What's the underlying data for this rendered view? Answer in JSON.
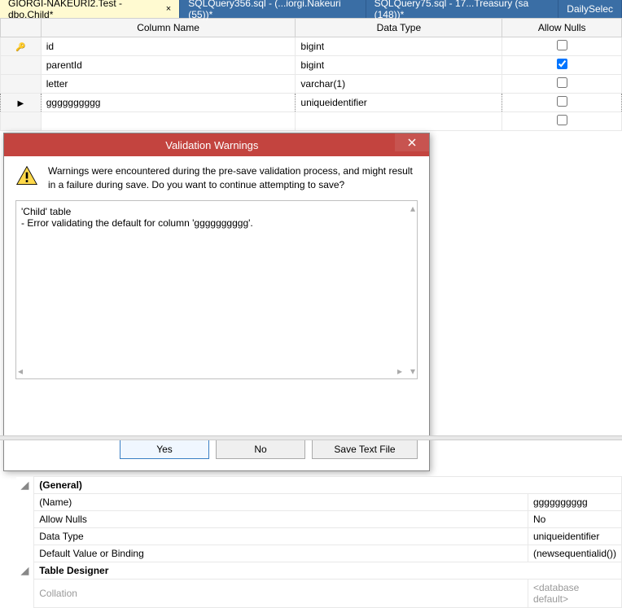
{
  "tabs": [
    {
      "label": "GIORGI-NAKEURI2.Test - dbo.Child*",
      "active": true
    },
    {
      "label": "SQLQuery356.sql - (...iorgi.Nakeuri (55))*",
      "active": false
    },
    {
      "label": "SQLQuery75.sql - 17...Treasury (sa (148))*",
      "active": false
    },
    {
      "label": "DailySelec",
      "active": false
    }
  ],
  "grid": {
    "headers": {
      "name": "Column Name",
      "type": "Data Type",
      "null": "Allow Nulls"
    },
    "rows": [
      {
        "key": true,
        "name": "id",
        "type": "bigint",
        "null": false
      },
      {
        "key": false,
        "name": "parentId",
        "type": "bigint",
        "null": true
      },
      {
        "key": false,
        "name": "letter",
        "type": "varchar(1)",
        "null": false
      },
      {
        "key": false,
        "editing": true,
        "name": "gggggggggg",
        "type": "uniqueidentifier",
        "null": false
      },
      {
        "key": false,
        "name": "",
        "type": "",
        "null": false
      }
    ]
  },
  "dialog": {
    "title": "Validation Warnings",
    "message": "Warnings were encountered during the pre-save validation process, and might result in a failure during save. Do you want to continue attempting to save?",
    "details_line1": "'Child' table",
    "details_line2": "- Error validating the default for column 'gggggggggg'.",
    "buttons": {
      "yes": "Yes",
      "no": "No",
      "save": "Save Text File"
    }
  },
  "props": {
    "cat1": "(General)",
    "name_lbl": "(Name)",
    "name_val": "gggggggggg",
    "null_lbl": "Allow Nulls",
    "null_val": "No",
    "type_lbl": "Data Type",
    "type_val": "uniqueidentifier",
    "def_lbl": "Default Value or Binding",
    "def_val": "(newsequentialid())",
    "cat2": "Table Designer",
    "coll_lbl": "Collation",
    "coll_val": "<database default>"
  }
}
